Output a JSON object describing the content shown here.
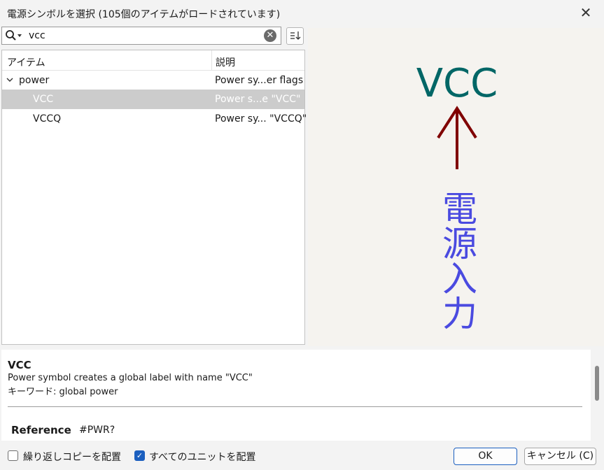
{
  "window": {
    "title": "電源シンボルを選択 (105個のアイテムがロードされています)"
  },
  "search": {
    "value": "vcc",
    "placeholder": ""
  },
  "tree": {
    "columns": [
      "アイテム",
      "説明"
    ],
    "rows": [
      {
        "name": "power",
        "desc": "Power sy...er flags",
        "expanded": true,
        "selected": false
      },
      {
        "name": "VCC",
        "desc": "Power s...e \"VCC\"",
        "selected": true
      },
      {
        "name": "VCCQ",
        "desc": "Power sy... \"VCCQ\"",
        "selected": false
      }
    ]
  },
  "preview": {
    "symbol_name": "VCC",
    "annotation": "電源入力",
    "colors": {
      "symbol_text": "#006666",
      "arrow": "#800000",
      "annotation": "#4a4ae0",
      "background": "#f5f3ef"
    }
  },
  "details": {
    "title": "VCC",
    "description": "Power symbol creates a global label with name \"VCC\"",
    "keywords": "キーワード: global power",
    "reference_label": "Reference",
    "reference_value": "#PWR?"
  },
  "footer": {
    "repeat_copy": {
      "label": "繰り返しコピーを配置",
      "checked": false
    },
    "all_units": {
      "label": "すべてのユニットを配置",
      "checked": true
    },
    "ok_label": "OK",
    "cancel_label": "キャンセル (C)"
  },
  "icons": [
    "search-icon",
    "chevron-down-icon",
    "clear-icon",
    "sort-icon",
    "close-icon",
    "checkmark-icon"
  ],
  "colors": {
    "accent": "#1b5fbf",
    "selection": "#cccccc"
  }
}
